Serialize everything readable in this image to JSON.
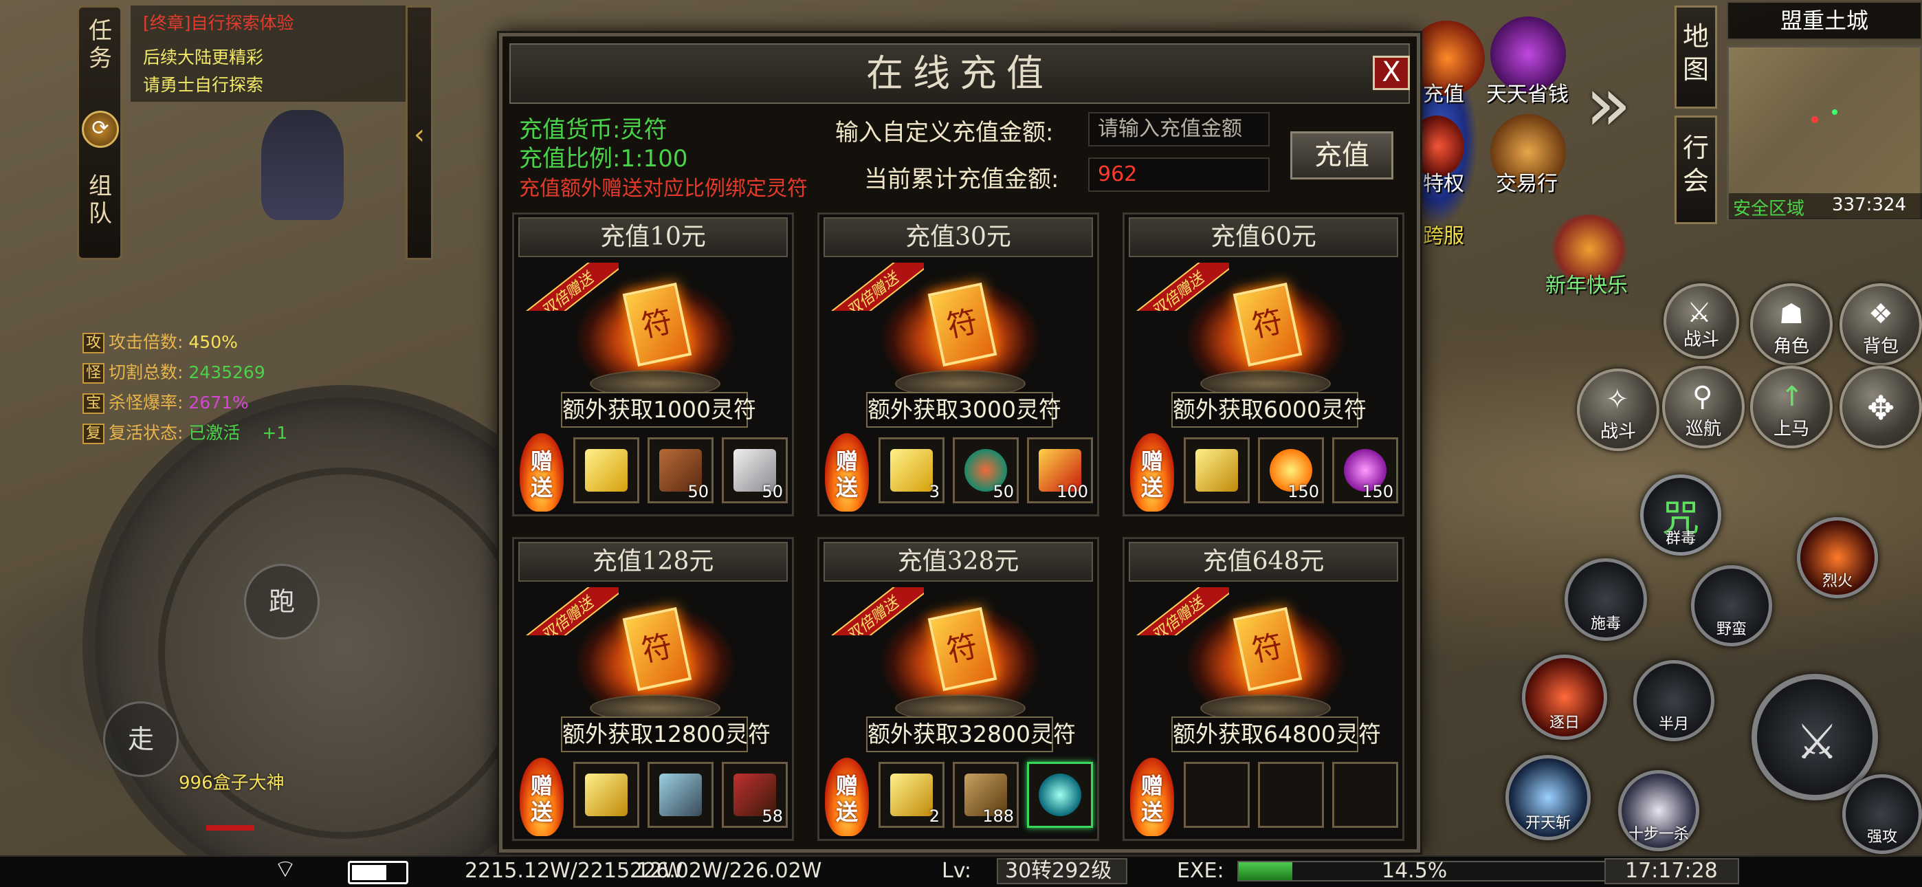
{
  "task_panel": {
    "side_buttons": [
      "任务",
      "组队"
    ],
    "lines": [
      {
        "text": "[终章]自行探索体验",
        "color": "#e33b2e"
      },
      {
        "text": "后续大陆更精彩",
        "color": "#f2e86a"
      },
      {
        "text": "请勇士自行探索",
        "color": "#f2e86a"
      }
    ]
  },
  "stats": [
    {
      "icon": "攻",
      "label": "攻击倍数:",
      "value": "450%",
      "color": "#f7e25a"
    },
    {
      "icon": "怪",
      "label": "切割总数:",
      "value": "2435269",
      "color": "#4ad34a"
    },
    {
      "icon": "宝",
      "label": "杀怪爆率:",
      "value": "2671%",
      "color": "#d546d5"
    },
    {
      "icon": "复",
      "label": "复活状态:",
      "value": "已激活",
      "color": "#4ad34a",
      "extra": "+1"
    }
  ],
  "joystick": {
    "run": "跑",
    "walk": "走"
  },
  "player_name": "996盒子大神",
  "dialog": {
    "title": "在线充值",
    "close": "X",
    "currency_label": "充值货币:",
    "currency_value": "灵符",
    "ratio_label": "充值比例:",
    "ratio_value": "1:100",
    "bonus_note": "充值额外赠送对应比例绑定灵符",
    "custom_amount_label": "输入自定义充值金额:",
    "custom_amount_placeholder": "请输入充值金额",
    "total_label": "当前累计充值金额:",
    "total_value": "962",
    "recharge_button": "充值",
    "ribbon_text": "双倍赠送",
    "gift_text": "赠送",
    "cards": [
      {
        "title": "充值10元",
        "bonus": "额外获取1000灵符",
        "items": [
          {
            "icon": "gold-bar",
            "count": ""
          },
          {
            "icon": "copper-ore",
            "count": "50"
          },
          {
            "icon": "silver-ore",
            "count": "50"
          }
        ]
      },
      {
        "title": "充值30元",
        "bonus": "额外获取3000灵符",
        "items": [
          {
            "icon": "gold-bar",
            "count": "3"
          },
          {
            "icon": "jade-stone",
            "count": "50"
          },
          {
            "icon": "fire-feather",
            "count": "100"
          }
        ]
      },
      {
        "title": "充值60元",
        "bonus": "额外获取6000灵符",
        "items": [
          {
            "icon": "gold-bars",
            "count": ""
          },
          {
            "icon": "sun-orb",
            "count": "150"
          },
          {
            "icon": "purple-orb",
            "count": "150"
          }
        ]
      },
      {
        "title": "充值128元",
        "bonus": "额外获取12800灵符",
        "items": [
          {
            "icon": "gold-bars",
            "count": ""
          },
          {
            "icon": "scroll",
            "count": ""
          },
          {
            "icon": "crossbow",
            "count": "58"
          }
        ]
      },
      {
        "title": "充值328元",
        "bonus": "额外获取32800灵符",
        "items": [
          {
            "icon": "gold-bars",
            "count": "2"
          },
          {
            "icon": "book",
            "count": "188"
          },
          {
            "icon": "teal-orb",
            "count": ""
          }
        ]
      },
      {
        "title": "充值648元",
        "bonus": "额外获取64800灵符",
        "items": [
          {
            "icon": "empty",
            "count": ""
          },
          {
            "icon": "empty",
            "count": ""
          },
          {
            "icon": "empty",
            "count": ""
          }
        ]
      }
    ]
  },
  "top_icons": [
    {
      "label": "充值"
    },
    {
      "label": "天天省钱"
    },
    {
      "label": "特权"
    },
    {
      "label": "交易行"
    },
    {
      "label": "跨服"
    },
    {
      "label": "新年快乐"
    }
  ],
  "map": {
    "buttons": [
      "地图",
      "行会"
    ],
    "name": "盟重土城",
    "zone": "安全区域",
    "coords": "337:324"
  },
  "right_buttons": {
    "battle_top": "战斗",
    "character": "角色",
    "bag": "背包",
    "battle": "战斗",
    "patrol": "巡航",
    "mount": "上马"
  },
  "skills": [
    {
      "label": "群毒",
      "glyph": "咒"
    },
    {
      "label": "烈火"
    },
    {
      "label": "施毒"
    },
    {
      "label": "野蛮"
    },
    {
      "label": "逐日"
    },
    {
      "label": "半月"
    },
    {
      "label": "开天斩"
    },
    {
      "label": "十步一杀"
    },
    {
      "label": "强攻"
    }
  ],
  "bottom_bar": {
    "hp_mp": "2215.12W/2215.12W",
    "mp": "226.02W/226.02W",
    "lv_label": "Lv:",
    "lv_value": "30转292级",
    "exe_label": "EXE:",
    "exe_percent": "14.5%",
    "exe_fraction": 0.145,
    "time": "17:17:28"
  }
}
